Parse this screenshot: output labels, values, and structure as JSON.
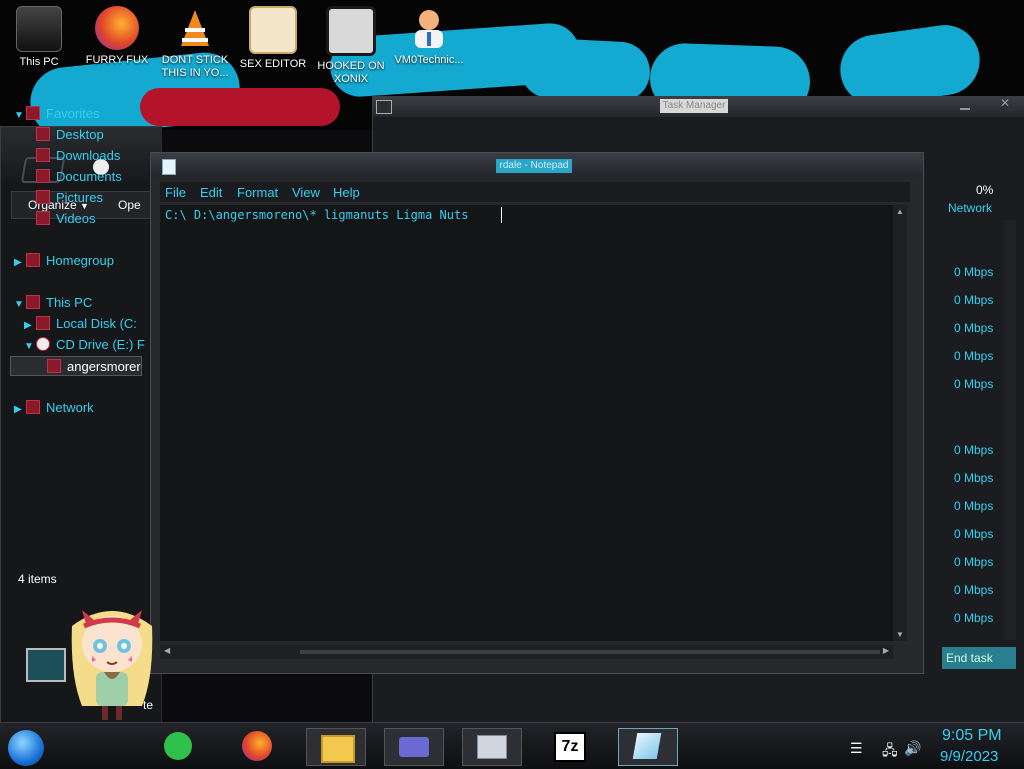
{
  "desktop": {
    "icons": [
      {
        "label": "This PC",
        "icon": "computer-icon"
      },
      {
        "label": "FURRY FUX",
        "icon": "firefox-icon"
      },
      {
        "label": "DONT STICK THIS IN YO...",
        "icon": "vlc-icon"
      },
      {
        "label": "SEX EDITOR",
        "icon": "xd-editor-icon"
      },
      {
        "label": "HOOKED ON XONIX",
        "icon": "game-icon"
      },
      {
        "label": "VM0Technic...",
        "icon": "doctor-avatar-icon"
      }
    ]
  },
  "explorer": {
    "toolbar": {
      "organize": "Organize",
      "open": "Ope"
    },
    "tree": {
      "favorites": "Favorites",
      "desktop": "Desktop",
      "downloads": "Downloads",
      "documents": "Documents",
      "pictures": "Pictures",
      "videos": "Videos",
      "homegroup": "Homegroup",
      "this_pc": "This PC",
      "local_disk": "Local Disk (C:",
      "cd_drive": "CD Drive (E:) F",
      "angersmoreno": "angersmorer",
      "network": "Network"
    },
    "status": "4 items",
    "status_right": "te"
  },
  "task_manager": {
    "title": "Task Manager",
    "network_pct": "0%",
    "network_label": "Network",
    "mbps_values": [
      "0 Mbps",
      "0 Mbps",
      "0 Mbps",
      "0 Mbps",
      "0 Mbps",
      "0 Mbps",
      "0 Mbps",
      "0 Mbps",
      "0 Mbps",
      "0 Mbps",
      "0 Mbps",
      "0 Mbps"
    ],
    "end_task": "End task"
  },
  "notepad": {
    "title": "rdale - Notepad",
    "menu": {
      "file": "File",
      "edit": "Edit",
      "format": "Format",
      "view": "View",
      "help": "Help"
    },
    "content": "C:\\ D:\\angersmoreno\\* ligmanuts Ligma Nuts"
  },
  "taskbar": {
    "time": "9:05 PM",
    "date": "9/9/2023",
    "pinned": [
      "sticky-notes-icon",
      "firefox-icon",
      "file-explorer-icon",
      "control-panel-icon",
      "task-manager-icon",
      "7zip-icon",
      "notepad-icon"
    ]
  },
  "colors": {
    "accent": "#34d0f0",
    "wallpaper_blue": "#14a9d0"
  }
}
